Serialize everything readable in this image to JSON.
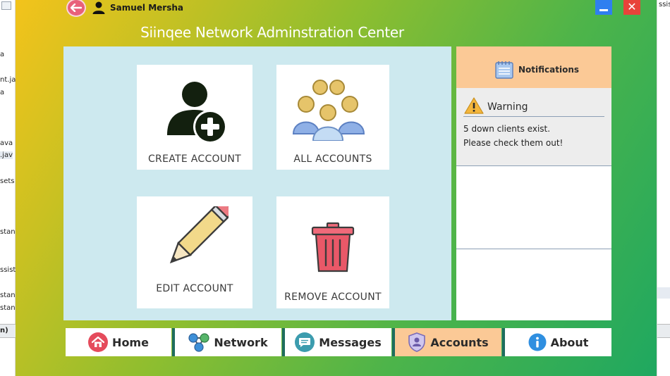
{
  "window": {
    "user_name": "Samuel Mersha",
    "title": "Siinqee Network Adminstration Center",
    "minimize_icon": "minimize-icon",
    "close_icon": "close-icon"
  },
  "background_ide": {
    "left_fragments": [
      "a",
      "nt.ja",
      "a",
      "ava",
      ".jav",
      "sets",
      "stan",
      "ssist",
      "stan",
      "stan",
      "n)"
    ],
    "right_fragments": [
      "ssista"
    ]
  },
  "tiles": [
    {
      "label": "CREATE ACCOUNT",
      "icon": "add-user-icon"
    },
    {
      "label": "ALL ACCOUNTS",
      "icon": "group-users-icon"
    },
    {
      "label": "EDIT ACCOUNT",
      "icon": "pencil-icon"
    },
    {
      "label": "REMOVE ACCOUNT",
      "icon": "trash-can-icon"
    }
  ],
  "notifications": {
    "header": "Notifications",
    "warning": {
      "title": "Warning",
      "line1": "5 down clients exist.",
      "line2": "Please check them out!"
    }
  },
  "nav": [
    {
      "label": "Home",
      "icon": "home-icon",
      "active": false
    },
    {
      "label": "Network",
      "icon": "network-icon",
      "active": false
    },
    {
      "label": "Messages",
      "icon": "chat-icon",
      "active": false
    },
    {
      "label": "Accounts",
      "icon": "user-shield-icon",
      "active": true
    },
    {
      "label": "About",
      "icon": "info-icon",
      "active": false
    }
  ],
  "colors": {
    "nav_active": "#fbc996",
    "content_bg": "#cde9ef",
    "header_bg": "#fbc996",
    "minimize": "#2f7ff0",
    "close": "#e8433a"
  }
}
